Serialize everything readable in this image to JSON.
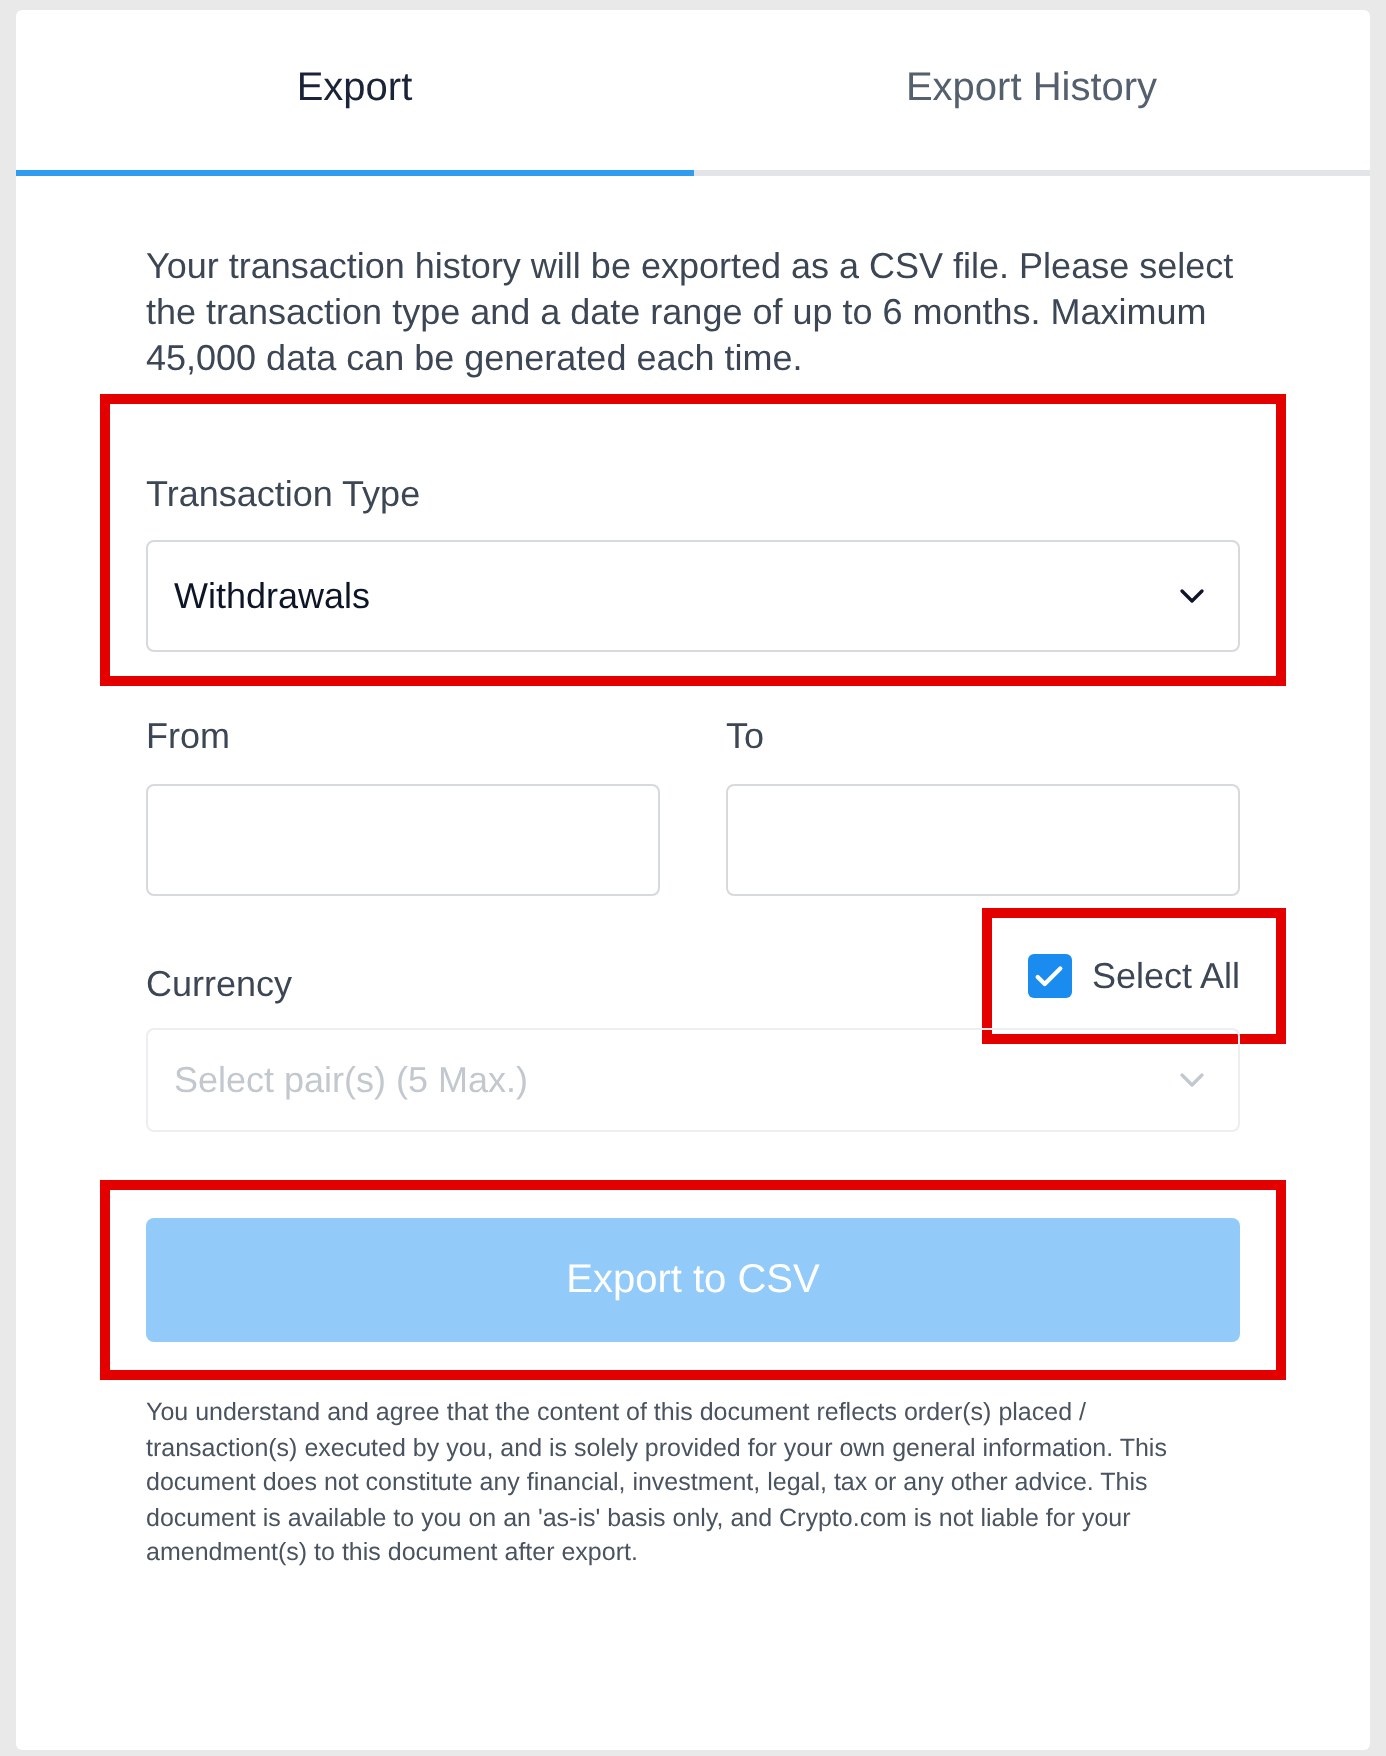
{
  "tabs": [
    {
      "label": "Export",
      "selected": true
    },
    {
      "label": "Export History",
      "selected": false
    }
  ],
  "intro": "Your transaction history will be exported as a CSV file. Please select the transaction type and a date range of up to 6 months. Maximum 45,000 data can be generated each time.",
  "transaction_type": {
    "label": "Transaction Type",
    "value": "Withdrawals",
    "highlighted": true
  },
  "from": {
    "label": "From"
  },
  "to": {
    "label": "To"
  },
  "currency": {
    "label": "Currency",
    "placeholder": "Select pair(s) (5 Max.)",
    "disabled": true
  },
  "select_all": {
    "label": "Select All",
    "checked": true,
    "highlighted": true
  },
  "export_button": {
    "label": "Export to CSV",
    "disabled": true,
    "highlighted": true
  },
  "disclaimer": "You understand and agree that the content of this document reflects order(s) placed / transaction(s) executed by you, and is solely provided for your own general information. This document does not constitute any financial, investment, legal, tax or any other advice. This document is available to you on an 'as-is' basis only, and Crypto.com is not liable for your amendment(s) to this document after export."
}
